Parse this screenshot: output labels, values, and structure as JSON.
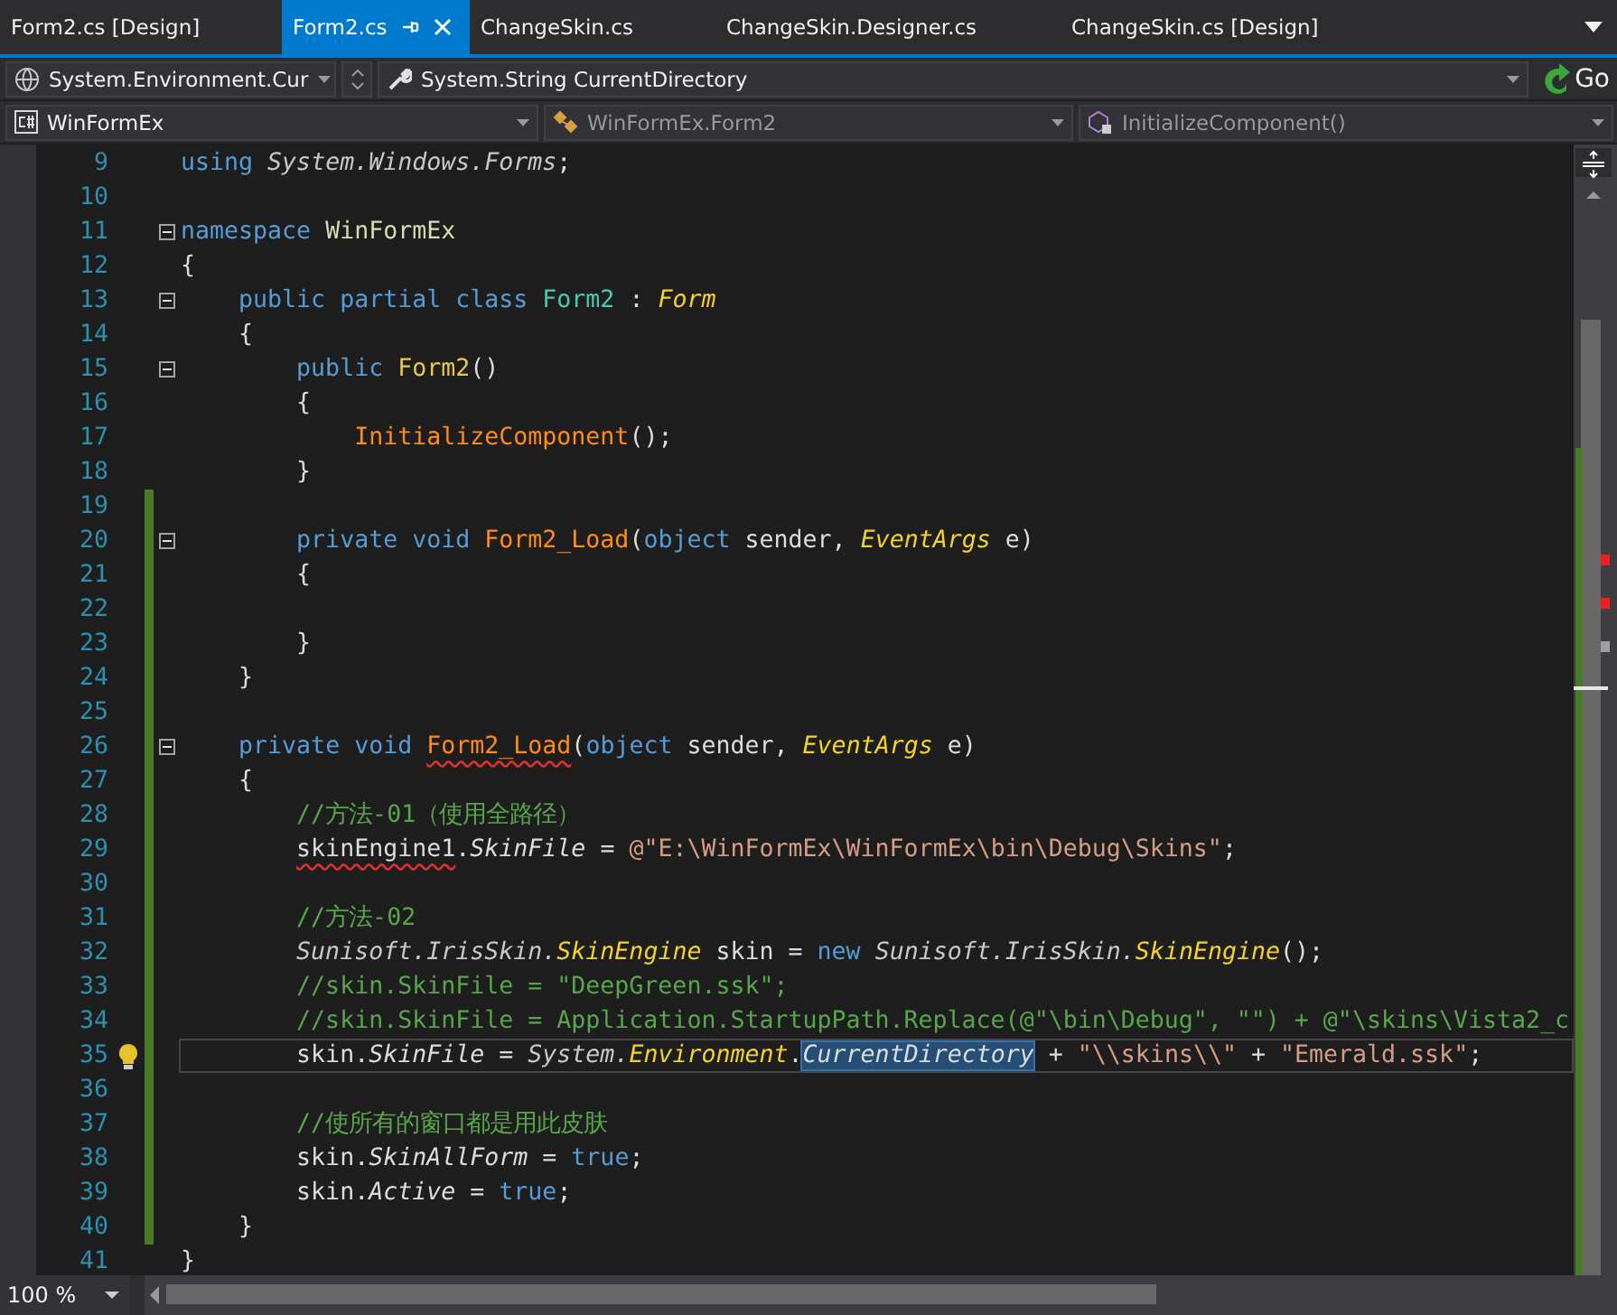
{
  "tabs": [
    {
      "label": "Form2.cs [Design]",
      "selected": false
    },
    {
      "label": "Form2.cs",
      "selected": true
    },
    {
      "label": "ChangeSkin.cs",
      "selected": false
    },
    {
      "label": "ChangeSkin.Designer.cs",
      "selected": false
    },
    {
      "label": "ChangeSkin.cs [Design]",
      "selected": false
    }
  ],
  "navigation": {
    "top": [
      {
        "text": "System.Environment.Cur",
        "disabled": false,
        "spinner": true
      },
      {
        "text": "System.String CurrentDirectory",
        "disabled": false,
        "spinner": false
      }
    ],
    "go": "Go",
    "bottom": [
      {
        "text": "WinFormEx",
        "disabled": false
      },
      {
        "text": "WinFormEx.Form2",
        "disabled": true
      },
      {
        "text": "InitializeComponent()",
        "disabled": true
      }
    ]
  },
  "editor": {
    "lines": [
      {
        "number": "9",
        "changed": false,
        "fold": false,
        "current": false,
        "bulb": false,
        "tokens": [
          {
            "kind": "kw",
            "text": "using "
          },
          {
            "kind": "ns",
            "text": "System.Windows.Forms"
          },
          {
            "kind": "plain",
            "text": ";"
          }
        ]
      },
      {
        "number": "10",
        "changed": false,
        "fold": false,
        "current": false,
        "bulb": false
      },
      {
        "number": "11",
        "changed": false,
        "fold": true,
        "current": false,
        "bulb": false,
        "tokens": [
          {
            "kind": "kw",
            "text": "namespace "
          },
          {
            "kind": "nsname",
            "text": "WinFormEx"
          }
        ]
      },
      {
        "number": "12",
        "changed": false,
        "fold": false,
        "current": false,
        "bulb": false,
        "tokens": [
          {
            "kind": "plain",
            "text": "{"
          }
        ]
      },
      {
        "number": "13",
        "changed": false,
        "fold": true,
        "current": false,
        "bulb": false,
        "tokens": [
          {
            "kind": "kw",
            "text": "    public partial class "
          },
          {
            "kind": "type",
            "text": "Form2"
          },
          {
            "kind": "plain",
            "text": " : "
          },
          {
            "kind": "typei",
            "text": "Form"
          }
        ]
      },
      {
        "number": "14",
        "changed": false,
        "fold": false,
        "current": false,
        "bulb": false,
        "tokens": [
          {
            "kind": "plain",
            "text": "    {"
          }
        ]
      },
      {
        "number": "15",
        "changed": false,
        "fold": true,
        "current": false,
        "bulb": false,
        "tokens": [
          {
            "kind": "kw",
            "text": "        public "
          },
          {
            "kind": "ctor",
            "text": "Form2"
          },
          {
            "kind": "plain",
            "text": "()"
          }
        ]
      },
      {
        "number": "16",
        "changed": false,
        "fold": false,
        "current": false,
        "bulb": false,
        "tokens": [
          {
            "kind": "plain",
            "text": "        {"
          }
        ]
      },
      {
        "number": "17",
        "changed": false,
        "fold": false,
        "current": false,
        "bulb": false,
        "tokens": [
          {
            "kind": "method",
            "text": "            InitializeComponent"
          },
          {
            "kind": "plain",
            "text": "();"
          }
        ]
      },
      {
        "number": "18",
        "changed": false,
        "fold": false,
        "current": false,
        "bulb": false,
        "tokens": [
          {
            "kind": "plain",
            "text": "        }"
          }
        ]
      },
      {
        "number": "19",
        "changed": true,
        "fold": false,
        "current": false,
        "bulb": false
      },
      {
        "number": "20",
        "changed": true,
        "fold": true,
        "current": false,
        "bulb": false,
        "tokens": [
          {
            "kind": "kw",
            "text": "        private void "
          },
          {
            "kind": "method",
            "text": "Form2_Load"
          },
          {
            "kind": "plain",
            "text": "("
          },
          {
            "kind": "kw",
            "text": "object"
          },
          {
            "kind": "plain",
            "text": " sender, "
          },
          {
            "kind": "typei",
            "text": "EventArgs"
          },
          {
            "kind": "plain",
            "text": " e)"
          }
        ]
      },
      {
        "number": "21",
        "changed": true,
        "fold": false,
        "current": false,
        "bulb": false,
        "tokens": [
          {
            "kind": "plain",
            "text": "        {"
          }
        ]
      },
      {
        "number": "22",
        "changed": true,
        "fold": false,
        "current": false,
        "bulb": false
      },
      {
        "number": "23",
        "changed": true,
        "fold": false,
        "current": false,
        "bulb": false,
        "tokens": [
          {
            "kind": "plain",
            "text": "        }"
          }
        ]
      },
      {
        "number": "24",
        "changed": true,
        "fold": false,
        "current": false,
        "bulb": false,
        "tokens": [
          {
            "kind": "plain",
            "text": "    }"
          }
        ]
      },
      {
        "number": "25",
        "changed": true,
        "fold": false,
        "current": false,
        "bulb": false
      },
      {
        "number": "26",
        "changed": true,
        "fold": true,
        "current": false,
        "bulb": false,
        "tokens": [
          {
            "kind": "kw",
            "text": "    private void "
          },
          {
            "kind": "method-error",
            "text": "Form2_Load"
          },
          {
            "kind": "plain",
            "text": "("
          },
          {
            "kind": "kw",
            "text": "object"
          },
          {
            "kind": "plain",
            "text": " sender, "
          },
          {
            "kind": "typei",
            "text": "EventArgs"
          },
          {
            "kind": "plain",
            "text": " e)"
          }
        ]
      },
      {
        "number": "27",
        "changed": true,
        "fold": false,
        "current": false,
        "bulb": false,
        "tokens": [
          {
            "kind": "plain",
            "text": "    {"
          }
        ]
      },
      {
        "number": "28",
        "changed": true,
        "fold": false,
        "current": false,
        "bulb": false,
        "tokens": [
          {
            "kind": "comment",
            "text": "        //方法-01（使用全路径）"
          }
        ]
      },
      {
        "number": "29",
        "changed": true,
        "fold": false,
        "current": false,
        "bulb": false,
        "tokens": [
          {
            "kind": "plain-error",
            "text": "        skinEngine1"
          },
          {
            "kind": "plain",
            "text": "."
          },
          {
            "kind": "prop",
            "text": "SkinFile"
          },
          {
            "kind": "plain",
            "text": " = "
          },
          {
            "kind": "str",
            "text": "@\"E:\\WinFormEx\\WinFormEx\\bin\\Debug\\Skins\""
          },
          {
            "kind": "plain",
            "text": ";"
          }
        ]
      },
      {
        "number": "30",
        "changed": true,
        "fold": false,
        "current": false,
        "bulb": false
      },
      {
        "number": "31",
        "changed": true,
        "fold": false,
        "current": false,
        "bulb": false,
        "tokens": [
          {
            "kind": "comment",
            "text": "        //方法-02"
          }
        ]
      },
      {
        "number": "32",
        "changed": true,
        "fold": false,
        "current": false,
        "bulb": false,
        "tokens": [
          {
            "kind": "ns",
            "text": "        Sunisoft.IrisSkin."
          },
          {
            "kind": "typei",
            "text": "SkinEngine"
          },
          {
            "kind": "plain",
            "text": " skin = "
          },
          {
            "kind": "kw",
            "text": "new "
          },
          {
            "kind": "ns",
            "text": "Sunisoft.IrisSkin."
          },
          {
            "kind": "typei",
            "text": "SkinEngine"
          },
          {
            "kind": "plain",
            "text": "();"
          }
        ]
      },
      {
        "number": "33",
        "changed": true,
        "fold": false,
        "current": false,
        "bulb": false,
        "tokens": [
          {
            "kind": "comment",
            "text": "        //skin.SkinFile = \"DeepGreen.ssk\";"
          }
        ]
      },
      {
        "number": "34",
        "changed": true,
        "fold": false,
        "current": false,
        "bulb": false,
        "tokens": [
          {
            "kind": "comment",
            "text": "        //skin.SkinFile = Application.StartupPath.Replace(@\"\\bin\\Debug\", \"\") + @\"\\skins\\Vista2_c"
          }
        ]
      },
      {
        "number": "35",
        "changed": true,
        "fold": false,
        "current": true,
        "bulb": true,
        "tokens": [
          {
            "kind": "plain",
            "text": "        skin."
          },
          {
            "kind": "prop",
            "text": "SkinFile"
          },
          {
            "kind": "plain",
            "text": " = "
          },
          {
            "kind": "ns",
            "text": "System."
          },
          {
            "kind": "typei",
            "text": "Environment"
          },
          {
            "kind": "plain",
            "text": "."
          },
          {
            "kind": "selection",
            "text": "CurrentDirectory"
          },
          {
            "kind": "plain",
            "text": " + "
          },
          {
            "kind": "str",
            "text": "\"\\\\skins\\\\\""
          },
          {
            "kind": "plain",
            "text": " + "
          },
          {
            "kind": "str",
            "text": "\"Emerald.ssk\""
          },
          {
            "kind": "plain",
            "text": ";"
          }
        ]
      },
      {
        "number": "36",
        "changed": true,
        "fold": false,
        "current": false,
        "bulb": false
      },
      {
        "number": "37",
        "changed": true,
        "fold": false,
        "current": false,
        "bulb": false,
        "tokens": [
          {
            "kind": "comment",
            "text": "        //使所有的窗口都是用此皮肤"
          }
        ]
      },
      {
        "number": "38",
        "changed": true,
        "fold": false,
        "current": false,
        "bulb": false,
        "tokens": [
          {
            "kind": "plain",
            "text": "        skin."
          },
          {
            "kind": "prop",
            "text": "SkinAllForm"
          },
          {
            "kind": "plain",
            "text": " = "
          },
          {
            "kind": "kw",
            "text": "true"
          },
          {
            "kind": "plain",
            "text": ";"
          }
        ]
      },
      {
        "number": "39",
        "changed": true,
        "fold": false,
        "current": false,
        "bulb": false,
        "tokens": [
          {
            "kind": "plain",
            "text": "        skin."
          },
          {
            "kind": "prop",
            "text": "Active"
          },
          {
            "kind": "plain",
            "text": " = "
          },
          {
            "kind": "kw",
            "text": "true"
          },
          {
            "kind": "plain",
            "text": ";"
          }
        ]
      },
      {
        "number": "40",
        "changed": true,
        "fold": false,
        "current": false,
        "bulb": false,
        "tokens": [
          {
            "kind": "plain",
            "text": "    }"
          }
        ]
      },
      {
        "number": "41",
        "changed": false,
        "fold": false,
        "current": false,
        "bulb": false,
        "tokens": [
          {
            "kind": "plain",
            "text": "}"
          }
        ]
      }
    ]
  },
  "status_bar": {
    "zoom": "100 %"
  }
}
